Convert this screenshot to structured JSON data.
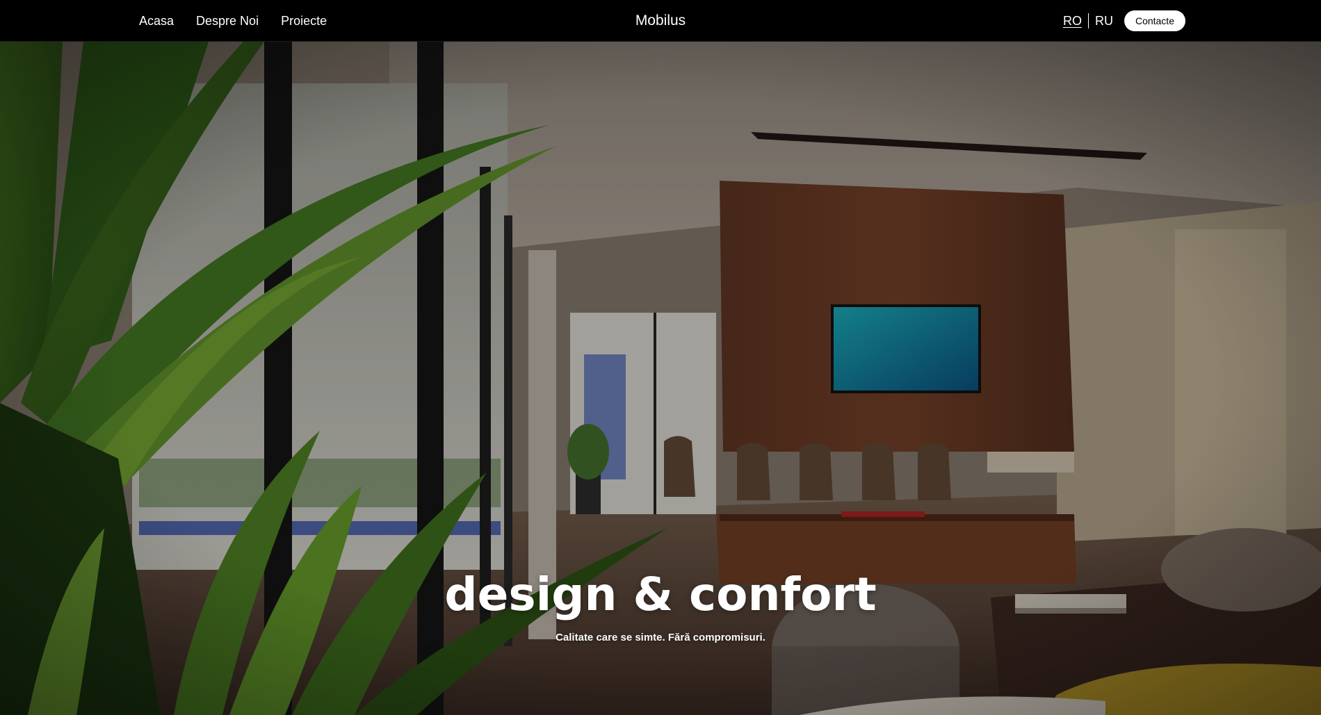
{
  "nav": {
    "links": [
      "Acasa",
      "Despre Noi",
      "Proiecte"
    ],
    "brand": "Mobilus",
    "languages": {
      "ro": "RO",
      "ru": "RU",
      "active": "RO"
    },
    "contact_label": "Contacte"
  },
  "hero": {
    "title": "design & confort",
    "subtitle": "Calitate care se simte. Fără compromisuri.",
    "background": "interior-living-room-photo"
  },
  "colors": {
    "header_bg": "#000000",
    "button_bg": "#ffffff",
    "text": "#ffffff"
  }
}
